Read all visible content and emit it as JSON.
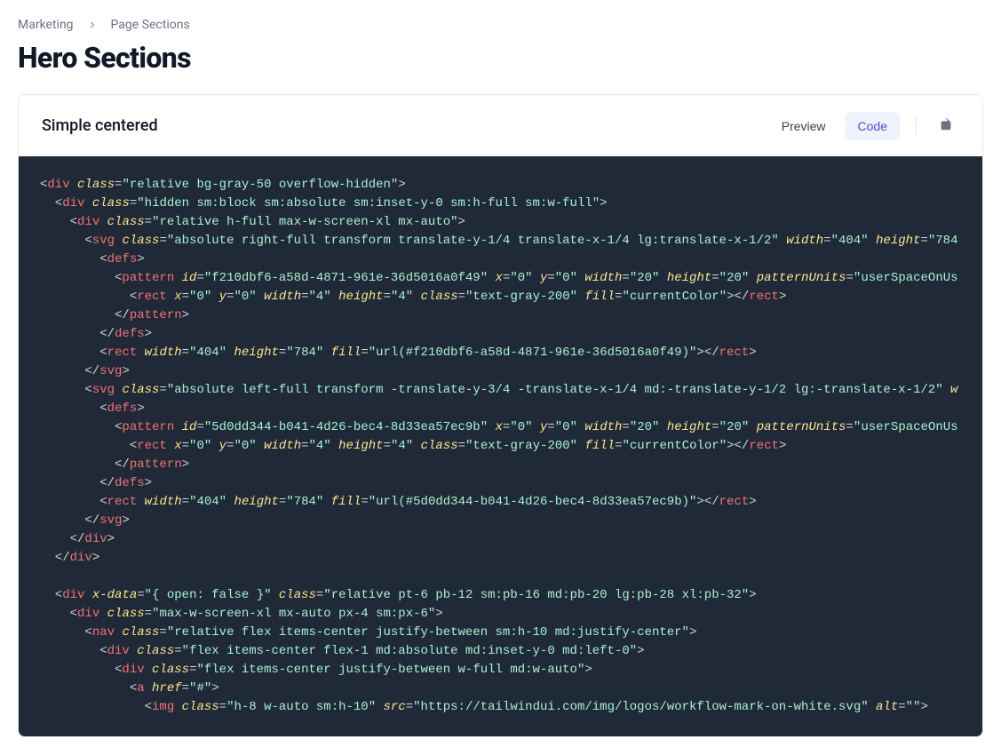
{
  "breadcrumb": {
    "item1": "Marketing",
    "item2": "Page Sections"
  },
  "page_title": "Hero Sections",
  "card": {
    "title": "Simple centered",
    "tabs": {
      "preview": "Preview",
      "code": "Code"
    }
  },
  "code": {
    "tokens": [
      [
        {
          "c": "p",
          "t": "<"
        },
        {
          "c": "t",
          "t": "div"
        },
        {
          "c": "p",
          "t": " "
        },
        {
          "c": "a",
          "t": "class"
        },
        {
          "c": "p",
          "t": "="
        },
        {
          "c": "s",
          "t": "\"relative bg-gray-50 overflow-hidden\""
        },
        {
          "c": "p",
          "t": ">"
        }
      ],
      [
        {
          "c": "p",
          "t": "  <"
        },
        {
          "c": "t",
          "t": "div"
        },
        {
          "c": "p",
          "t": " "
        },
        {
          "c": "a",
          "t": "class"
        },
        {
          "c": "p",
          "t": "="
        },
        {
          "c": "s",
          "t": "\"hidden sm:block sm:absolute sm:inset-y-0 sm:h-full sm:w-full\""
        },
        {
          "c": "p",
          "t": ">"
        }
      ],
      [
        {
          "c": "p",
          "t": "    <"
        },
        {
          "c": "t",
          "t": "div"
        },
        {
          "c": "p",
          "t": " "
        },
        {
          "c": "a",
          "t": "class"
        },
        {
          "c": "p",
          "t": "="
        },
        {
          "c": "s",
          "t": "\"relative h-full max-w-screen-xl mx-auto\""
        },
        {
          "c": "p",
          "t": ">"
        }
      ],
      [
        {
          "c": "p",
          "t": "      <"
        },
        {
          "c": "t",
          "t": "svg"
        },
        {
          "c": "p",
          "t": " "
        },
        {
          "c": "a",
          "t": "class"
        },
        {
          "c": "p",
          "t": "="
        },
        {
          "c": "s",
          "t": "\"absolute right-full transform translate-y-1/4 translate-x-1/4 lg:translate-x-1/2\""
        },
        {
          "c": "p",
          "t": " "
        },
        {
          "c": "a",
          "t": "width"
        },
        {
          "c": "p",
          "t": "="
        },
        {
          "c": "s",
          "t": "\"404\""
        },
        {
          "c": "p",
          "t": " "
        },
        {
          "c": "a",
          "t": "height"
        },
        {
          "c": "p",
          "t": "="
        },
        {
          "c": "s",
          "t": "\"784"
        }
      ],
      [
        {
          "c": "p",
          "t": "        <"
        },
        {
          "c": "t",
          "t": "defs"
        },
        {
          "c": "p",
          "t": ">"
        }
      ],
      [
        {
          "c": "p",
          "t": "          <"
        },
        {
          "c": "t",
          "t": "pattern"
        },
        {
          "c": "p",
          "t": " "
        },
        {
          "c": "a",
          "t": "id"
        },
        {
          "c": "p",
          "t": "="
        },
        {
          "c": "s",
          "t": "\"f210dbf6-a58d-4871-961e-36d5016a0f49\""
        },
        {
          "c": "p",
          "t": " "
        },
        {
          "c": "a",
          "t": "x"
        },
        {
          "c": "p",
          "t": "="
        },
        {
          "c": "s",
          "t": "\"0\""
        },
        {
          "c": "p",
          "t": " "
        },
        {
          "c": "a",
          "t": "y"
        },
        {
          "c": "p",
          "t": "="
        },
        {
          "c": "s",
          "t": "\"0\""
        },
        {
          "c": "p",
          "t": " "
        },
        {
          "c": "a",
          "t": "width"
        },
        {
          "c": "p",
          "t": "="
        },
        {
          "c": "s",
          "t": "\"20\""
        },
        {
          "c": "p",
          "t": " "
        },
        {
          "c": "a",
          "t": "height"
        },
        {
          "c": "p",
          "t": "="
        },
        {
          "c": "s",
          "t": "\"20\""
        },
        {
          "c": "p",
          "t": " "
        },
        {
          "c": "a",
          "t": "patternUnits"
        },
        {
          "c": "p",
          "t": "="
        },
        {
          "c": "s",
          "t": "\"userSpaceOnUs"
        }
      ],
      [
        {
          "c": "p",
          "t": "            <"
        },
        {
          "c": "t",
          "t": "rect"
        },
        {
          "c": "p",
          "t": " "
        },
        {
          "c": "a",
          "t": "x"
        },
        {
          "c": "p",
          "t": "="
        },
        {
          "c": "s",
          "t": "\"0\""
        },
        {
          "c": "p",
          "t": " "
        },
        {
          "c": "a",
          "t": "y"
        },
        {
          "c": "p",
          "t": "="
        },
        {
          "c": "s",
          "t": "\"0\""
        },
        {
          "c": "p",
          "t": " "
        },
        {
          "c": "a",
          "t": "width"
        },
        {
          "c": "p",
          "t": "="
        },
        {
          "c": "s",
          "t": "\"4\""
        },
        {
          "c": "p",
          "t": " "
        },
        {
          "c": "a",
          "t": "height"
        },
        {
          "c": "p",
          "t": "="
        },
        {
          "c": "s",
          "t": "\"4\""
        },
        {
          "c": "p",
          "t": " "
        },
        {
          "c": "a",
          "t": "class"
        },
        {
          "c": "p",
          "t": "="
        },
        {
          "c": "s",
          "t": "\"text-gray-200\""
        },
        {
          "c": "p",
          "t": " "
        },
        {
          "c": "a",
          "t": "fill"
        },
        {
          "c": "p",
          "t": "="
        },
        {
          "c": "s",
          "t": "\"currentColor\""
        },
        {
          "c": "p",
          "t": "></"
        },
        {
          "c": "t",
          "t": "rect"
        },
        {
          "c": "p",
          "t": ">"
        }
      ],
      [
        {
          "c": "p",
          "t": "          </"
        },
        {
          "c": "t",
          "t": "pattern"
        },
        {
          "c": "p",
          "t": ">"
        }
      ],
      [
        {
          "c": "p",
          "t": "        </"
        },
        {
          "c": "t",
          "t": "defs"
        },
        {
          "c": "p",
          "t": ">"
        }
      ],
      [
        {
          "c": "p",
          "t": "        <"
        },
        {
          "c": "t",
          "t": "rect"
        },
        {
          "c": "p",
          "t": " "
        },
        {
          "c": "a",
          "t": "width"
        },
        {
          "c": "p",
          "t": "="
        },
        {
          "c": "s",
          "t": "\"404\""
        },
        {
          "c": "p",
          "t": " "
        },
        {
          "c": "a",
          "t": "height"
        },
        {
          "c": "p",
          "t": "="
        },
        {
          "c": "s",
          "t": "\"784\""
        },
        {
          "c": "p",
          "t": " "
        },
        {
          "c": "a",
          "t": "fill"
        },
        {
          "c": "p",
          "t": "="
        },
        {
          "c": "s",
          "t": "\"url(#f210dbf6-a58d-4871-961e-36d5016a0f49)\""
        },
        {
          "c": "p",
          "t": "></"
        },
        {
          "c": "t",
          "t": "rect"
        },
        {
          "c": "p",
          "t": ">"
        }
      ],
      [
        {
          "c": "p",
          "t": "      </"
        },
        {
          "c": "t",
          "t": "svg"
        },
        {
          "c": "p",
          "t": ">"
        }
      ],
      [
        {
          "c": "p",
          "t": "      <"
        },
        {
          "c": "t",
          "t": "svg"
        },
        {
          "c": "p",
          "t": " "
        },
        {
          "c": "a",
          "t": "class"
        },
        {
          "c": "p",
          "t": "="
        },
        {
          "c": "s",
          "t": "\"absolute left-full transform -translate-y-3/4 -translate-x-1/4 md:-translate-y-1/2 lg:-translate-x-1/2\""
        },
        {
          "c": "p",
          "t": " "
        },
        {
          "c": "a",
          "t": "w"
        }
      ],
      [
        {
          "c": "p",
          "t": "        <"
        },
        {
          "c": "t",
          "t": "defs"
        },
        {
          "c": "p",
          "t": ">"
        }
      ],
      [
        {
          "c": "p",
          "t": "          <"
        },
        {
          "c": "t",
          "t": "pattern"
        },
        {
          "c": "p",
          "t": " "
        },
        {
          "c": "a",
          "t": "id"
        },
        {
          "c": "p",
          "t": "="
        },
        {
          "c": "s",
          "t": "\"5d0dd344-b041-4d26-bec4-8d33ea57ec9b\""
        },
        {
          "c": "p",
          "t": " "
        },
        {
          "c": "a",
          "t": "x"
        },
        {
          "c": "p",
          "t": "="
        },
        {
          "c": "s",
          "t": "\"0\""
        },
        {
          "c": "p",
          "t": " "
        },
        {
          "c": "a",
          "t": "y"
        },
        {
          "c": "p",
          "t": "="
        },
        {
          "c": "s",
          "t": "\"0\""
        },
        {
          "c": "p",
          "t": " "
        },
        {
          "c": "a",
          "t": "width"
        },
        {
          "c": "p",
          "t": "="
        },
        {
          "c": "s",
          "t": "\"20\""
        },
        {
          "c": "p",
          "t": " "
        },
        {
          "c": "a",
          "t": "height"
        },
        {
          "c": "p",
          "t": "="
        },
        {
          "c": "s",
          "t": "\"20\""
        },
        {
          "c": "p",
          "t": " "
        },
        {
          "c": "a",
          "t": "patternUnits"
        },
        {
          "c": "p",
          "t": "="
        },
        {
          "c": "s",
          "t": "\"userSpaceOnUs"
        }
      ],
      [
        {
          "c": "p",
          "t": "            <"
        },
        {
          "c": "t",
          "t": "rect"
        },
        {
          "c": "p",
          "t": " "
        },
        {
          "c": "a",
          "t": "x"
        },
        {
          "c": "p",
          "t": "="
        },
        {
          "c": "s",
          "t": "\"0\""
        },
        {
          "c": "p",
          "t": " "
        },
        {
          "c": "a",
          "t": "y"
        },
        {
          "c": "p",
          "t": "="
        },
        {
          "c": "s",
          "t": "\"0\""
        },
        {
          "c": "p",
          "t": " "
        },
        {
          "c": "a",
          "t": "width"
        },
        {
          "c": "p",
          "t": "="
        },
        {
          "c": "s",
          "t": "\"4\""
        },
        {
          "c": "p",
          "t": " "
        },
        {
          "c": "a",
          "t": "height"
        },
        {
          "c": "p",
          "t": "="
        },
        {
          "c": "s",
          "t": "\"4\""
        },
        {
          "c": "p",
          "t": " "
        },
        {
          "c": "a",
          "t": "class"
        },
        {
          "c": "p",
          "t": "="
        },
        {
          "c": "s",
          "t": "\"text-gray-200\""
        },
        {
          "c": "p",
          "t": " "
        },
        {
          "c": "a",
          "t": "fill"
        },
        {
          "c": "p",
          "t": "="
        },
        {
          "c": "s",
          "t": "\"currentColor\""
        },
        {
          "c": "p",
          "t": "></"
        },
        {
          "c": "t",
          "t": "rect"
        },
        {
          "c": "p",
          "t": ">"
        }
      ],
      [
        {
          "c": "p",
          "t": "          </"
        },
        {
          "c": "t",
          "t": "pattern"
        },
        {
          "c": "p",
          "t": ">"
        }
      ],
      [
        {
          "c": "p",
          "t": "        </"
        },
        {
          "c": "t",
          "t": "defs"
        },
        {
          "c": "p",
          "t": ">"
        }
      ],
      [
        {
          "c": "p",
          "t": "        <"
        },
        {
          "c": "t",
          "t": "rect"
        },
        {
          "c": "p",
          "t": " "
        },
        {
          "c": "a",
          "t": "width"
        },
        {
          "c": "p",
          "t": "="
        },
        {
          "c": "s",
          "t": "\"404\""
        },
        {
          "c": "p",
          "t": " "
        },
        {
          "c": "a",
          "t": "height"
        },
        {
          "c": "p",
          "t": "="
        },
        {
          "c": "s",
          "t": "\"784\""
        },
        {
          "c": "p",
          "t": " "
        },
        {
          "c": "a",
          "t": "fill"
        },
        {
          "c": "p",
          "t": "="
        },
        {
          "c": "s",
          "t": "\"url(#5d0dd344-b041-4d26-bec4-8d33ea57ec9b)\""
        },
        {
          "c": "p",
          "t": "></"
        },
        {
          "c": "t",
          "t": "rect"
        },
        {
          "c": "p",
          "t": ">"
        }
      ],
      [
        {
          "c": "p",
          "t": "      </"
        },
        {
          "c": "t",
          "t": "svg"
        },
        {
          "c": "p",
          "t": ">"
        }
      ],
      [
        {
          "c": "p",
          "t": "    </"
        },
        {
          "c": "t",
          "t": "div"
        },
        {
          "c": "p",
          "t": ">"
        }
      ],
      [
        {
          "c": "p",
          "t": "  </"
        },
        {
          "c": "t",
          "t": "div"
        },
        {
          "c": "p",
          "t": ">"
        }
      ],
      [],
      [
        {
          "c": "p",
          "t": "  <"
        },
        {
          "c": "t",
          "t": "div"
        },
        {
          "c": "p",
          "t": " "
        },
        {
          "c": "a",
          "t": "x-data"
        },
        {
          "c": "p",
          "t": "="
        },
        {
          "c": "s",
          "t": "\"{ open: false }\""
        },
        {
          "c": "p",
          "t": " "
        },
        {
          "c": "a",
          "t": "class"
        },
        {
          "c": "p",
          "t": "="
        },
        {
          "c": "s",
          "t": "\"relative pt-6 pb-12 sm:pb-16 md:pb-20 lg:pb-28 xl:pb-32\""
        },
        {
          "c": "p",
          "t": ">"
        }
      ],
      [
        {
          "c": "p",
          "t": "    <"
        },
        {
          "c": "t",
          "t": "div"
        },
        {
          "c": "p",
          "t": " "
        },
        {
          "c": "a",
          "t": "class"
        },
        {
          "c": "p",
          "t": "="
        },
        {
          "c": "s",
          "t": "\"max-w-screen-xl mx-auto px-4 sm:px-6\""
        },
        {
          "c": "p",
          "t": ">"
        }
      ],
      [
        {
          "c": "p",
          "t": "      <"
        },
        {
          "c": "t",
          "t": "nav"
        },
        {
          "c": "p",
          "t": " "
        },
        {
          "c": "a",
          "t": "class"
        },
        {
          "c": "p",
          "t": "="
        },
        {
          "c": "s",
          "t": "\"relative flex items-center justify-between sm:h-10 md:justify-center\""
        },
        {
          "c": "p",
          "t": ">"
        }
      ],
      [
        {
          "c": "p",
          "t": "        <"
        },
        {
          "c": "t",
          "t": "div"
        },
        {
          "c": "p",
          "t": " "
        },
        {
          "c": "a",
          "t": "class"
        },
        {
          "c": "p",
          "t": "="
        },
        {
          "c": "s",
          "t": "\"flex items-center flex-1 md:absolute md:inset-y-0 md:left-0\""
        },
        {
          "c": "p",
          "t": ">"
        }
      ],
      [
        {
          "c": "p",
          "t": "          <"
        },
        {
          "c": "t",
          "t": "div"
        },
        {
          "c": "p",
          "t": " "
        },
        {
          "c": "a",
          "t": "class"
        },
        {
          "c": "p",
          "t": "="
        },
        {
          "c": "s",
          "t": "\"flex items-center justify-between w-full md:w-auto\""
        },
        {
          "c": "p",
          "t": ">"
        }
      ],
      [
        {
          "c": "p",
          "t": "            <"
        },
        {
          "c": "t",
          "t": "a"
        },
        {
          "c": "p",
          "t": " "
        },
        {
          "c": "a",
          "t": "href"
        },
        {
          "c": "p",
          "t": "="
        },
        {
          "c": "s",
          "t": "\"#\""
        },
        {
          "c": "p",
          "t": ">"
        }
      ],
      [
        {
          "c": "p",
          "t": "              <"
        },
        {
          "c": "t",
          "t": "img"
        },
        {
          "c": "p",
          "t": " "
        },
        {
          "c": "a",
          "t": "class"
        },
        {
          "c": "p",
          "t": "="
        },
        {
          "c": "s",
          "t": "\"h-8 w-auto sm:h-10\""
        },
        {
          "c": "p",
          "t": " "
        },
        {
          "c": "a",
          "t": "src"
        },
        {
          "c": "p",
          "t": "="
        },
        {
          "c": "s",
          "t": "\"https://tailwindui.com/img/logos/workflow-mark-on-white.svg\""
        },
        {
          "c": "p",
          "t": " "
        },
        {
          "c": "a",
          "t": "alt"
        },
        {
          "c": "p",
          "t": "="
        },
        {
          "c": "s",
          "t": "\"\""
        },
        {
          "c": "p",
          "t": ">"
        }
      ]
    ]
  }
}
